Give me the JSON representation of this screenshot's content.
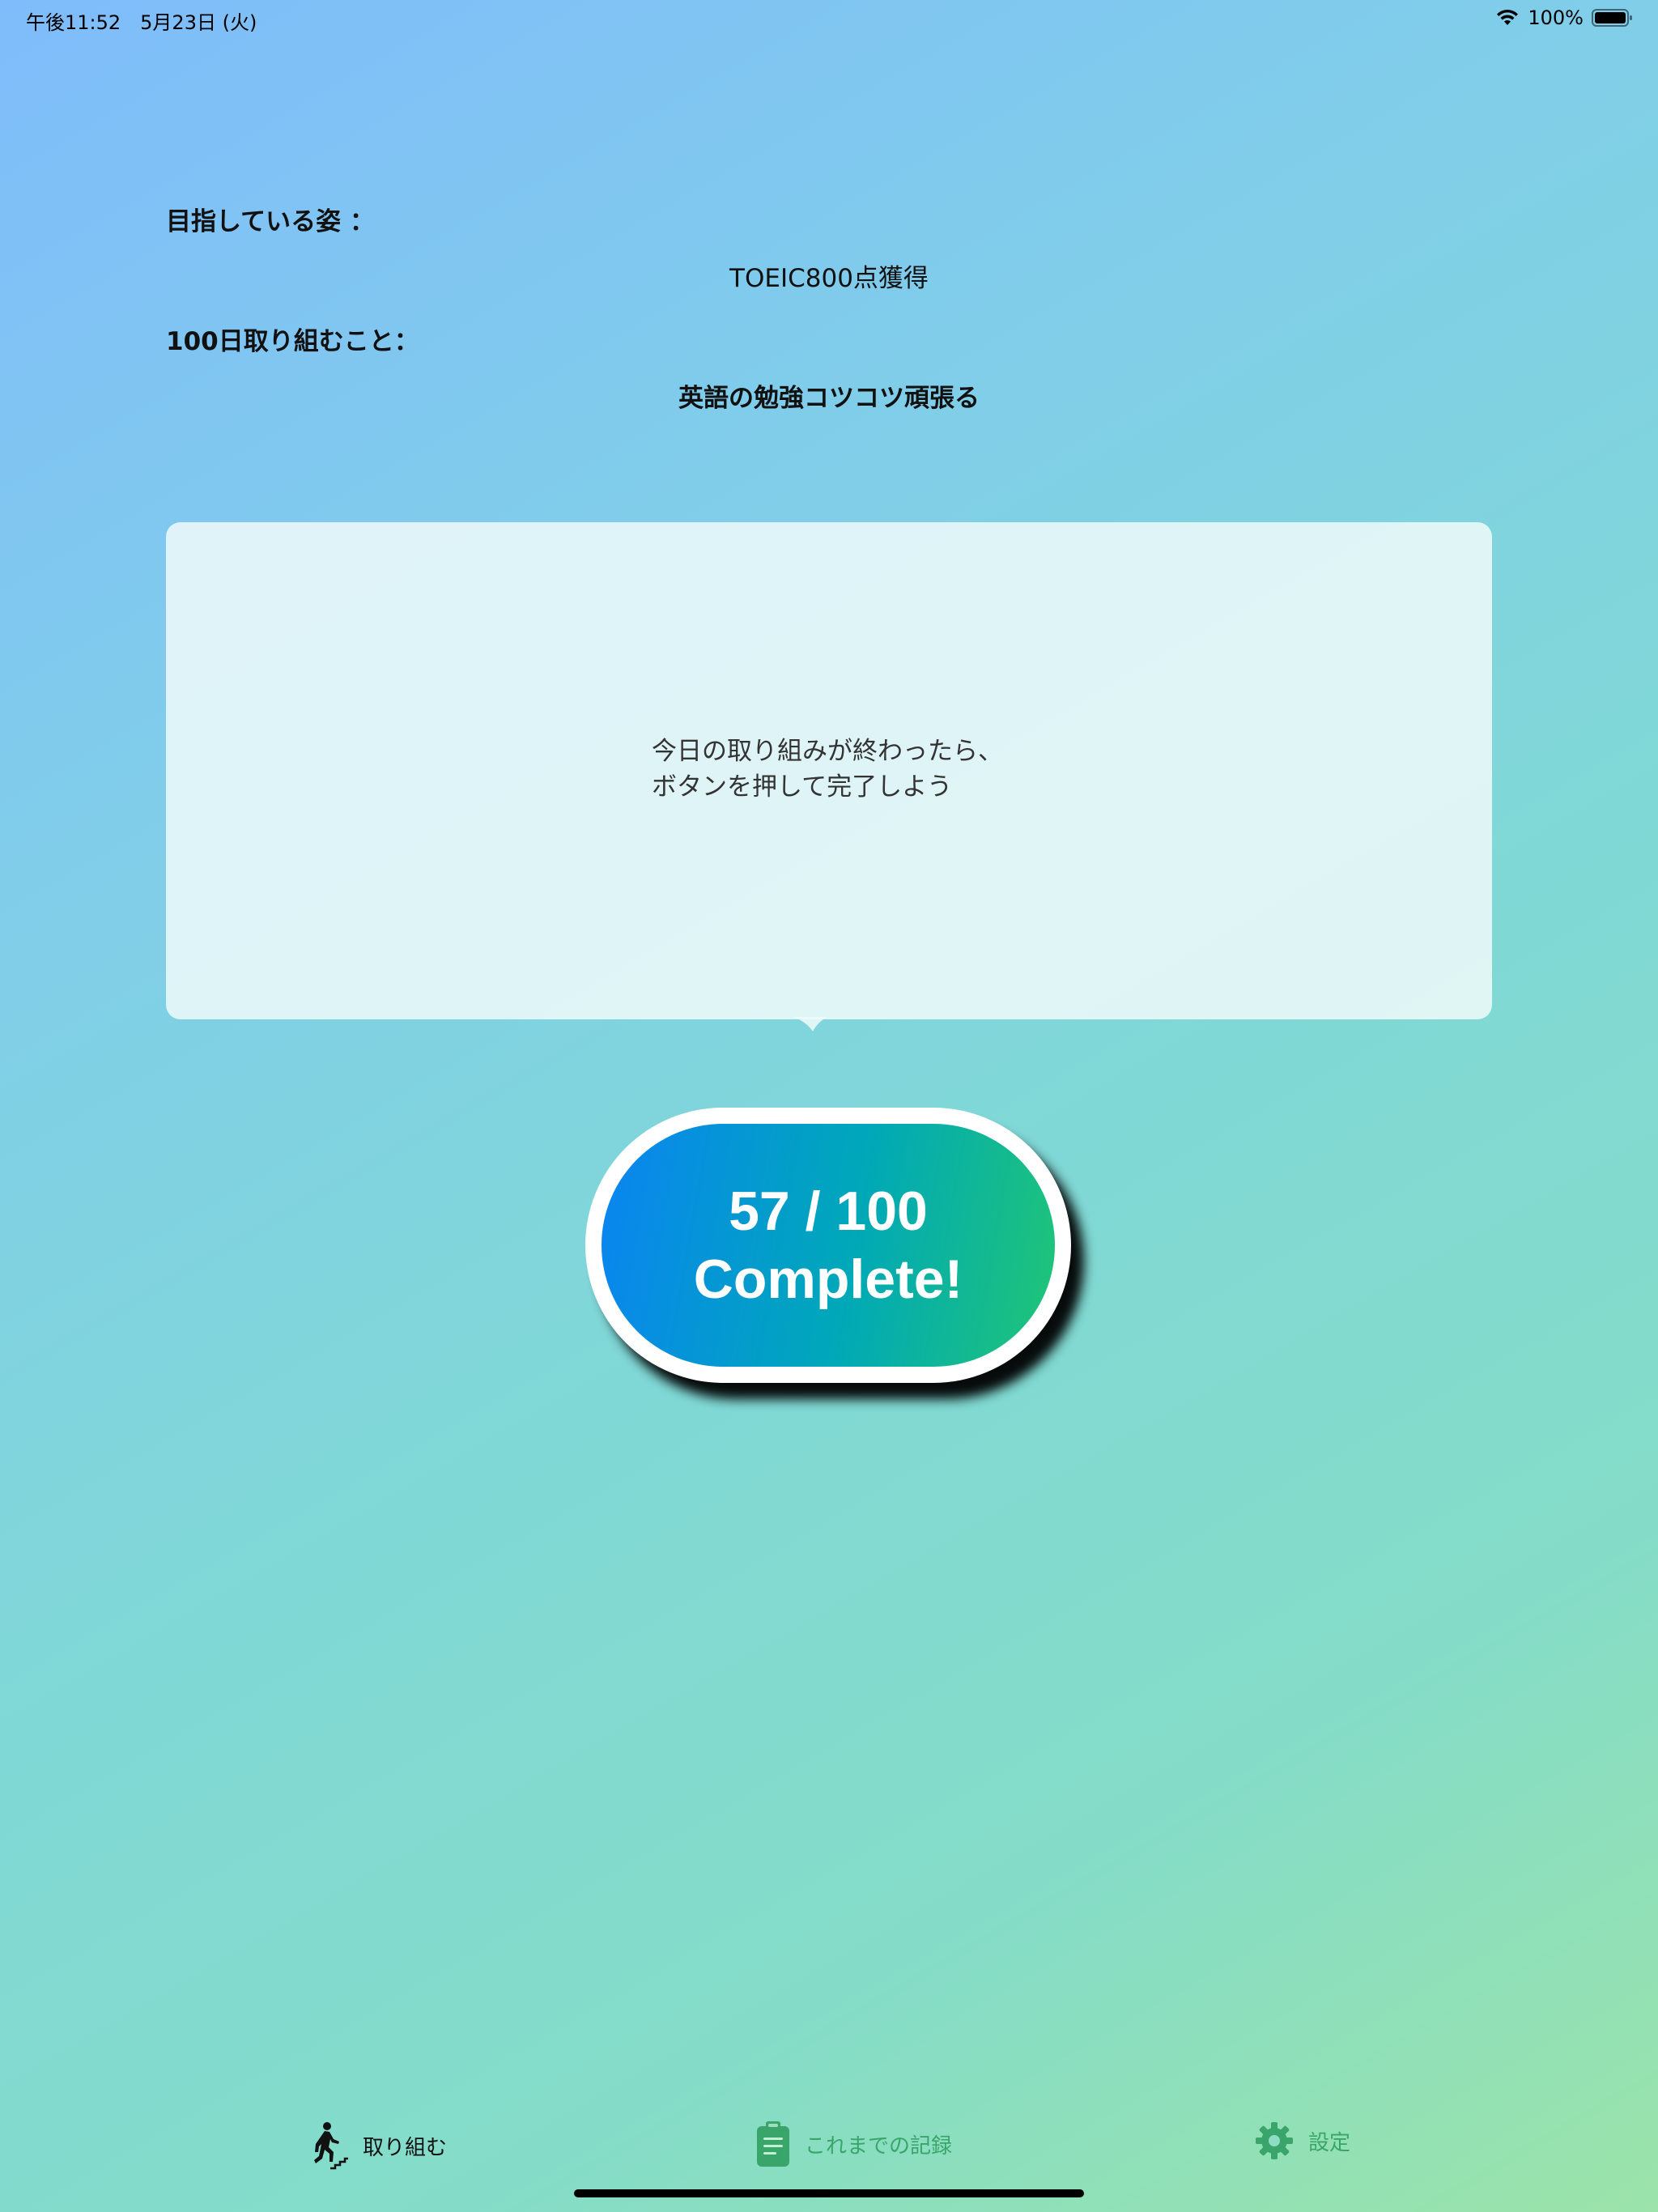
{
  "status_bar": {
    "time": "午後11:52　5月23日 (火)",
    "battery": "100%"
  },
  "goal": {
    "label": "目指している姿 ：",
    "value": "TOEIC800点獲得"
  },
  "commitment": {
    "label": "100日取り組むこと：",
    "value": "英語の勉強コツコツ頑張る"
  },
  "bubble": {
    "line1": "今日の取り組みが終わったら、",
    "line2": "ボタンを押して完了しよう"
  },
  "complete_button": {
    "count": "57 / 100",
    "label": "Complete!",
    "progress": 57,
    "total": 100
  },
  "tabs": {
    "tasks": "取り組む",
    "history": "これまでの記録",
    "settings": "設定"
  },
  "colors": {
    "button_gradient_start": "#0a84f2",
    "button_gradient_end": "#20c576",
    "tab_inactive": "#3aa56a",
    "tab_active": "#111111"
  },
  "icons": {
    "tasks": "person-climbing-stairs-icon",
    "history": "clipboard-icon",
    "settings": "gear-icon",
    "wifi": "wifi-icon",
    "battery": "battery-icon"
  }
}
